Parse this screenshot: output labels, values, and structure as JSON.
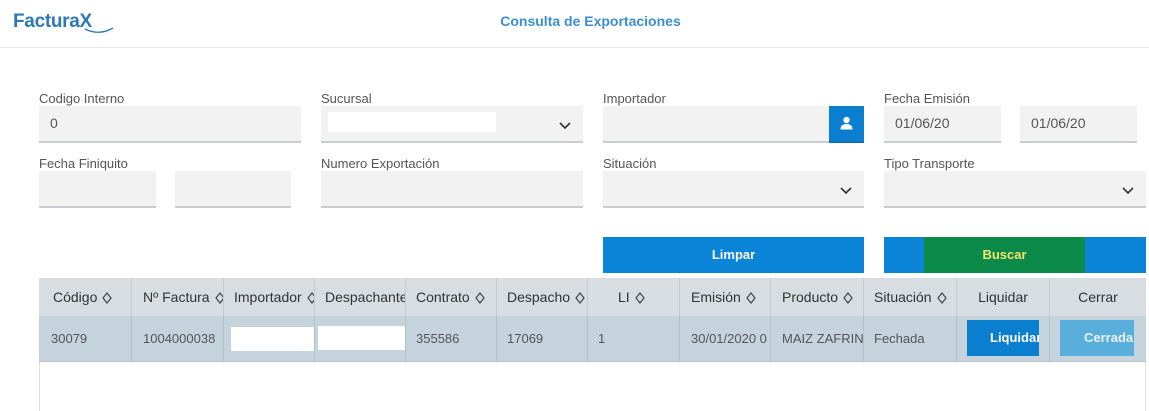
{
  "app": {
    "logo_text": "Factura",
    "logo_mark": "X",
    "page_title": "Consulta de Exportaciones"
  },
  "filters": {
    "codigo_interno": {
      "label": "Codigo Interno",
      "value": "0"
    },
    "sucursal": {
      "label": "Sucursal",
      "value": ""
    },
    "importador": {
      "label": "Importador",
      "value": ""
    },
    "fecha_emision": {
      "label": "Fecha Emisión",
      "from": "01/06/20",
      "to": "01/06/20"
    },
    "fecha_finiquito": {
      "label": "Fecha Finiquito",
      "from": "",
      "to": ""
    },
    "numero_exportacion": {
      "label": "Numero Exportación",
      "value": ""
    },
    "situacion": {
      "label": "Situación",
      "value": ""
    },
    "tipo_transporte": {
      "label": "Tipo Transporte",
      "value": ""
    }
  },
  "actions": {
    "limpar": "Limpar",
    "buscar": "Buscar"
  },
  "grid": {
    "columns": [
      "Código",
      "Nº Factura",
      "Importador",
      "Despachante",
      "Contrato",
      "Despacho",
      "LI",
      "Emisión",
      "Producto",
      "Situación",
      "Liquidar",
      "Cerrar"
    ],
    "rows": [
      {
        "codigo": "30079",
        "factura": "1004000038",
        "importador": "",
        "despachante": "",
        "contrato": "355586",
        "despacho": "17069",
        "li": "1",
        "emision": "30/01/2020 0",
        "producto": "MAIZ ZAFRIN",
        "situacion": "Fechada",
        "liquidar": "Liquidar",
        "cerrar": "Cerrada"
      }
    ]
  },
  "colors": {
    "primary": "#0a84d6",
    "buscar_bg": "#0b8a4a",
    "buscar_text": "#f4e46c",
    "row_bg": "#c5d3dc",
    "header_bg": "#d7dde1"
  }
}
